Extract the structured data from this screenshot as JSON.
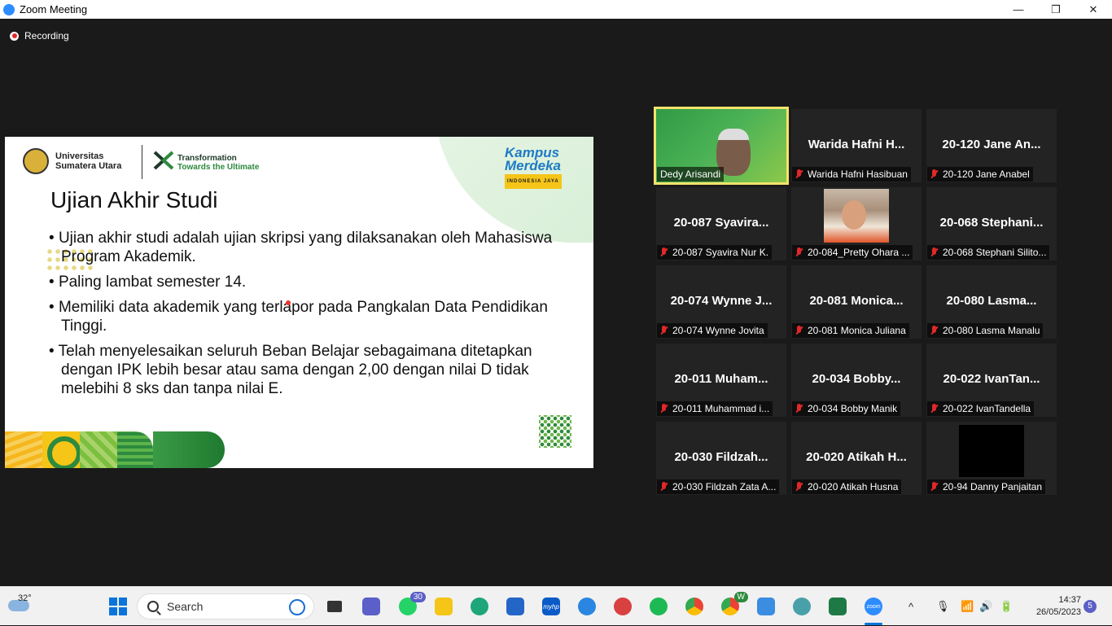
{
  "window": {
    "title": "Zoom Meeting",
    "minimize": "—",
    "maximize": "❐",
    "close": "✕"
  },
  "recording": {
    "label": "Recording"
  },
  "slide": {
    "university_line1": "Universitas",
    "university_line2": "Sumatera Utara",
    "transformation_line1": "Transformation",
    "transformation_line2": "Towards the Ultimate",
    "kampus_line1": "Kampus",
    "kampus_line2": "Merdeka",
    "kampus_tag": "INDONESIA JAYA",
    "title": "Ujian Akhir Studi",
    "bullets": [
      "Ujian akhir studi adalah ujian skripsi yang dilaksanakan oleh Mahasiswa Program Akademik.",
      "Paling lambat semester 14.",
      "Memiliki data akademik yang terlapor pada Pangkalan Data Pendidikan Tinggi.",
      "Telah menyelesaikan seluruh Beban Belajar sebagaimana ditetapkan dengan IPK lebih besar atau sama dengan 2,00 dengan nilai D tidak melebihi 8 sks dan tanpa nilai E."
    ]
  },
  "participants": [
    {
      "display": "",
      "label": "Dedy Arisandi",
      "muted": false
    },
    {
      "display": "Warida  Hafni  H...",
      "label": "Warida Hafni Hasibuan",
      "muted": true
    },
    {
      "display": "20-120  Jane  An...",
      "label": "20-120 Jane Anabel",
      "muted": true
    },
    {
      "display": "20-087  Syavira...",
      "label": "20-087 Syavira Nur K.",
      "muted": true
    },
    {
      "display": "",
      "label": "20-084_Pretty Ohara ...",
      "muted": true
    },
    {
      "display": "20-068  Stephani...",
      "label": "20-068 Stephani Silito...",
      "muted": true
    },
    {
      "display": "20-074  Wynne  J...",
      "label": "20-074 Wynne Jovita",
      "muted": true
    },
    {
      "display": "20-081  Monica...",
      "label": "20-081 Monica Juliana",
      "muted": true
    },
    {
      "display": "20-080  Lasma...",
      "label": "20-080 Lasma Manalu",
      "muted": true
    },
    {
      "display": "20-011  Muham...",
      "label": "20-011 Muhammad i...",
      "muted": true
    },
    {
      "display": "20-034  Bobby...",
      "label": "20-034 Bobby Manik",
      "muted": true
    },
    {
      "display": "20-022  IvanTan...",
      "label": "20-022 IvanTandella",
      "muted": true
    },
    {
      "display": "20-030  Fildzah...",
      "label": "20-030 Fildzah Zata A...",
      "muted": true
    },
    {
      "display": "20-020  Atikah  H...",
      "label": "20-020 Atikah Husna",
      "muted": true
    },
    {
      "display": "",
      "label": "20-94 Danny Panjaitan",
      "muted": true
    }
  ],
  "taskbar": {
    "temperature": "32°",
    "search_placeholder": "Search",
    "whatsapp_badge": "30",
    "chrome_badge": "W",
    "time": "14:37",
    "date": "26/05/2023",
    "notifications": "5",
    "myhp_label": "myhp",
    "zoom_label": "zoom"
  },
  "colors": {
    "accent": "#2d8cff",
    "active_speaker": "#f5e36b",
    "muted_mic": "#e02828",
    "taskbar_accent": "#0a74da"
  }
}
